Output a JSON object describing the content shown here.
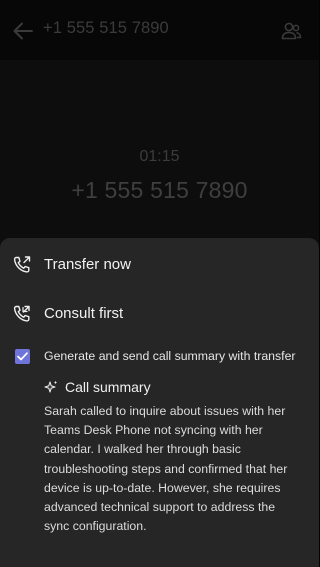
{
  "header": {
    "title": "+1 555 515 7890"
  },
  "call": {
    "timer": "01:15",
    "callee": "+1 555 515 7890"
  },
  "transfer_sheet": {
    "options": [
      {
        "label": "Transfer now",
        "icon": "phone-forward-icon"
      },
      {
        "label": "Consult first",
        "icon": "phone-consult-icon"
      }
    ],
    "summary_checkbox": {
      "label": "Generate and send call summary with transfer",
      "checked": true
    },
    "summary": {
      "title": "Call summary",
      "icon": "sparkle-icon",
      "text": "Sarah called to inquire about issues with her Teams Desk Phone not syncing with her calendar. I walked her through basic troubleshooting steps and confirmed that her device is up-to-date. However, she requires advanced technical support to address the sync configuration."
    }
  },
  "colors": {
    "accent": "#6f74d8",
    "sheet_background": "#262626",
    "background": "#0d0d0d"
  }
}
